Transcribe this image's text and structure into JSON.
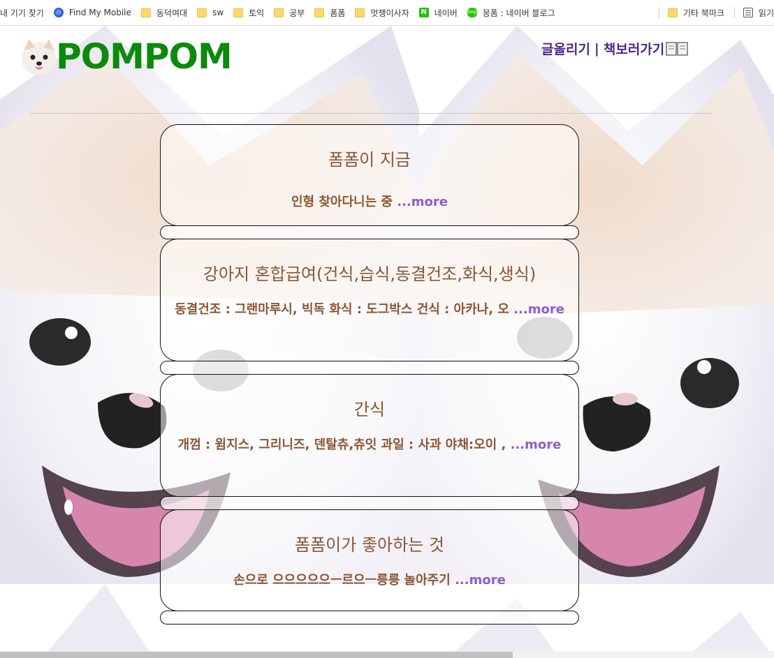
{
  "bookmarks": [
    {
      "label": "내 기기 찾기",
      "icon": "none"
    },
    {
      "label": "Find My Mobile",
      "icon": "find-my-mobile-icon"
    },
    {
      "label": "동덕여대",
      "icon": "folder-icon"
    },
    {
      "label": "sw",
      "icon": "folder-icon"
    },
    {
      "label": "토익",
      "icon": "folder-icon"
    },
    {
      "label": "공부",
      "icon": "folder-icon"
    },
    {
      "label": "폼폼",
      "icon": "folder-icon"
    },
    {
      "label": "멋쟁이사자",
      "icon": "folder-icon"
    },
    {
      "label": "네이버",
      "icon": "naver-icon"
    },
    {
      "label": "몽폼 : 네이버 블로그",
      "icon": "blog-icon"
    }
  ],
  "bookmarks_right": [
    {
      "label": "기타 북마크",
      "icon": "folder-icon"
    },
    {
      "label": "읽기",
      "icon": "reading-list-icon"
    }
  ],
  "header": {
    "brand": "POMPOM",
    "nav_write": "글올리기",
    "nav_sep": "|",
    "nav_books": "책보러가기"
  },
  "cards": [
    {
      "title": "폼폼이 지금",
      "body": "인형 찾아다니는 중",
      "more": "...more"
    },
    {
      "title": "강아지 혼합급여(건식,습식,동결건조,화식,생식)",
      "body": "동결건조 : 그랜마루시, 빅독 화식 : 도그박스 건식 : 아카나, 오",
      "more": "...more"
    },
    {
      "title": "간식",
      "body": "개껌 : 윔지스, 그리니즈, 덴탈츄,츄잇 과일 : 사과 야채:오이 ,",
      "more": "...more"
    },
    {
      "title": "폼폼이가 좋아하는 것",
      "body": "손으로 으으으으으ㅡ르으ㅡ릉릉 놀아주기",
      "more": "...more"
    }
  ],
  "colors": {
    "brand": "#0c8a0c",
    "nav": "#4b2a8a",
    "card_text": "#8b5533",
    "more": "#8c5fc7"
  }
}
